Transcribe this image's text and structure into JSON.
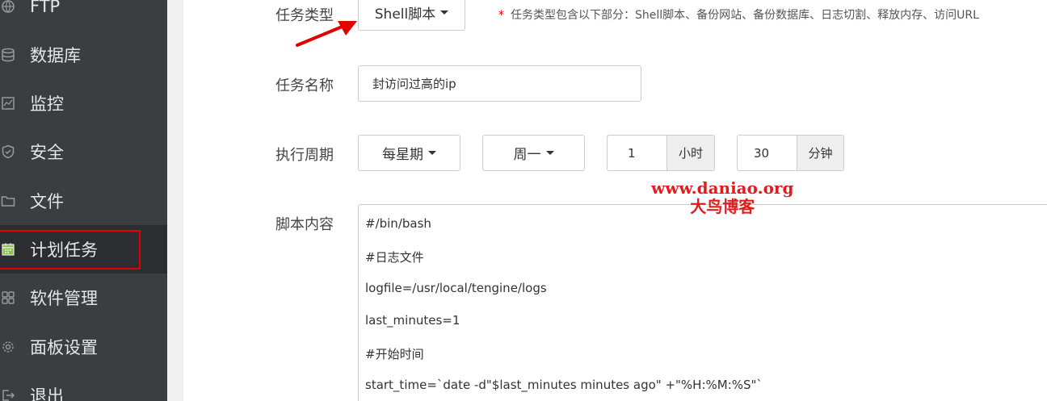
{
  "sidebar": {
    "items": [
      {
        "label": "FTP",
        "icon": "ftp-icon"
      },
      {
        "label": "数据库",
        "icon": "database-icon"
      },
      {
        "label": "监控",
        "icon": "monitor-icon"
      },
      {
        "label": "安全",
        "icon": "shield-icon"
      },
      {
        "label": "文件",
        "icon": "folder-icon"
      },
      {
        "label": "计划任务",
        "icon": "calendar-icon",
        "active": true
      },
      {
        "label": "软件管理",
        "icon": "grid-icon"
      },
      {
        "label": "面板设置",
        "icon": "gear-icon"
      },
      {
        "label": "退出",
        "icon": "logout-icon"
      }
    ],
    "highlight_color": "#e00000"
  },
  "form": {
    "task_type": {
      "label": "任务类型",
      "value": "Shell脚本",
      "hint_star": "*",
      "hint": "任务类型包含以下部分：Shell脚本、备份网站、备份数据库、日志切割、释放内存、访问URL"
    },
    "task_name": {
      "label": "任务名称",
      "value": "封访问过高的ip"
    },
    "period": {
      "label": "执行周期",
      "frequency": "每星期",
      "weekday": "周一",
      "hour": "1",
      "hour_unit": "小时",
      "minute": "30",
      "minute_unit": "分钟"
    },
    "script": {
      "label": "脚本内容",
      "lines": [
        "#/bin/bash",
        "#日志文件",
        "logfile=/usr/local/tengine/logs",
        "last_minutes=1",
        "#开始时间",
        "start_time=`date -d\"$last_minutes minutes ago\" +\"%H:%M:%S\"`"
      ]
    }
  },
  "watermark": {
    "line1": "www.daniao.org",
    "line2": "大鸟博客",
    "color": "#e21c1c"
  }
}
